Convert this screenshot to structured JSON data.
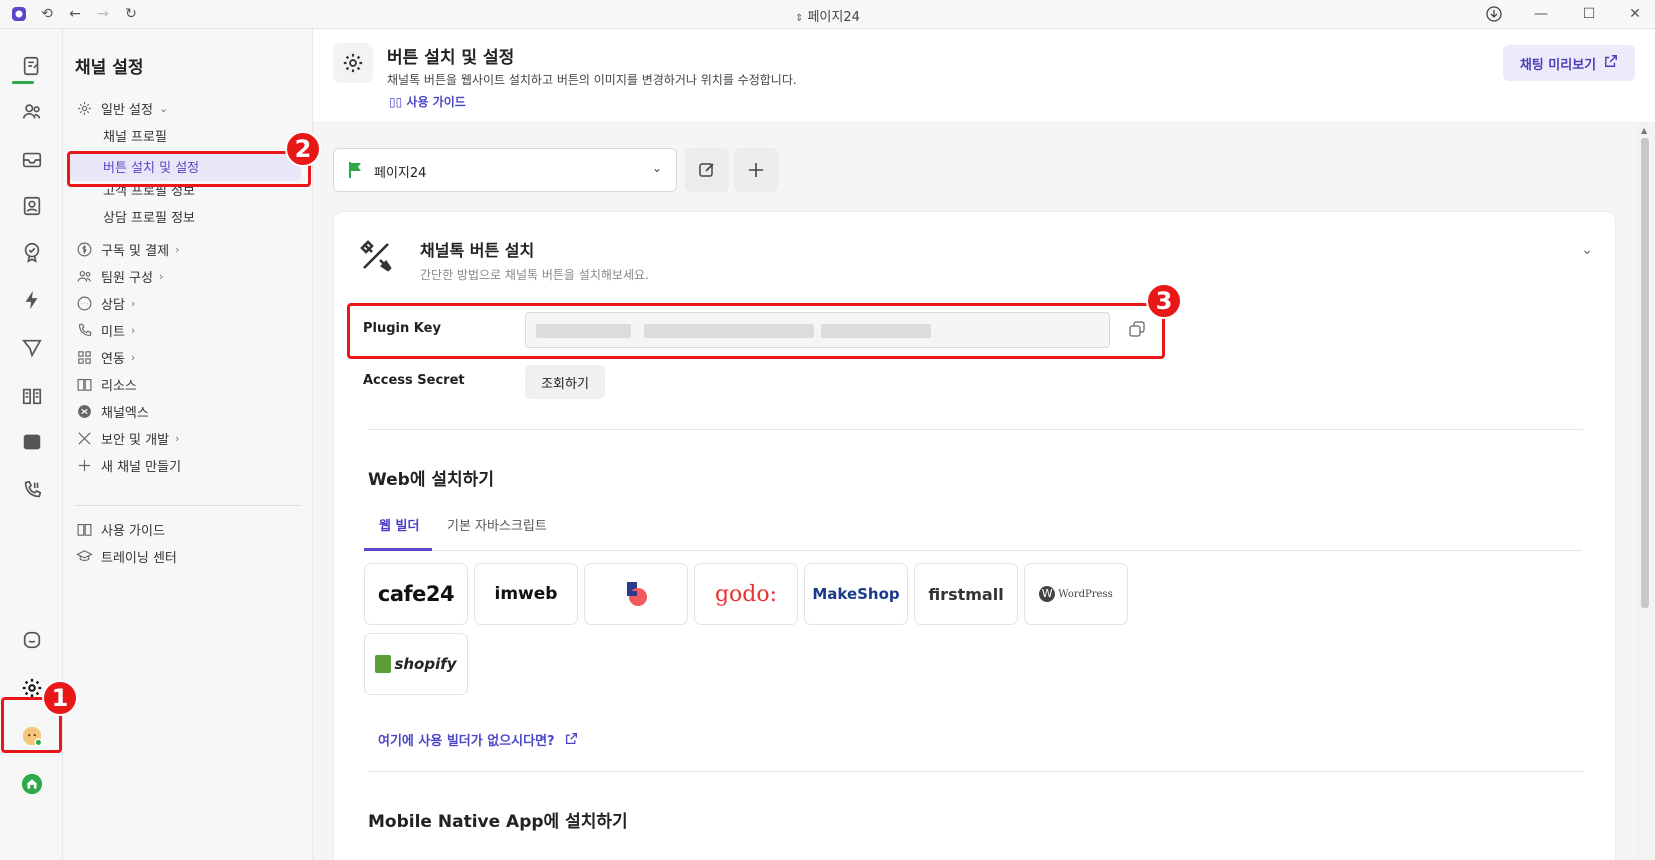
{
  "titlebar": {
    "title": "페이지24"
  },
  "sidebar": {
    "heading": "채널 설정",
    "general": "일반 설정",
    "sub": {
      "profile": "채널 프로필",
      "button_settings": "버튼 설치 및 설정",
      "customer_profile": "고객 프로필 정보",
      "consult_profile": "상담 프로필 정보"
    },
    "items": [
      {
        "label": "구독 및 결제",
        "icon": "dollar-icon",
        "caret": true
      },
      {
        "label": "팀원 구성",
        "icon": "team-icon",
        "caret": true
      },
      {
        "label": "상담",
        "icon": "chat-icon",
        "caret": true
      },
      {
        "label": "미트",
        "icon": "phone-icon",
        "caret": true
      },
      {
        "label": "연동",
        "icon": "grid-icon",
        "caret": true
      },
      {
        "label": "리소스",
        "icon": "book-icon",
        "caret": false
      },
      {
        "label": "채널엑스",
        "icon": "channelx-icon",
        "caret": false
      },
      {
        "label": "보안 및 개발",
        "icon": "tools-icon",
        "caret": true
      },
      {
        "label": "새 채널 만들기",
        "icon": "plus-icon",
        "caret": false
      }
    ],
    "footer": [
      {
        "label": "사용 가이드",
        "icon": "book-icon"
      },
      {
        "label": "트레이닝 센터",
        "icon": "graduation-cap-icon"
      }
    ]
  },
  "header": {
    "title": "버튼 설치 및 설정",
    "description": "채널톡 버튼을 웹사이트 설치하고 버튼의 이미지를 변경하거나 위치를 수정합니다.",
    "guide_link": "사용 가이드",
    "preview_button": "채팅 미리보기"
  },
  "channel_select": {
    "value": "페이지24"
  },
  "card": {
    "title": "채널톡 버튼 설치",
    "description": "간단한 방법으로 채널톡 버튼을 설치해보세요.",
    "plugin_key_label": "Plugin Key",
    "access_secret_label": "Access Secret",
    "view_button": "조회하기",
    "web_section_title": "Web에 설치하기",
    "tabs": [
      "웹 빌더",
      "기본 자바스크립트"
    ],
    "builders": [
      "cafe24",
      "imweb",
      "",
      "godo:",
      "MakeShop",
      "firstmall",
      "WordPress",
      "shopify"
    ],
    "builder_link": "여기에 사용 빌더가 없으시다면?",
    "mobile_section_title": "Mobile Native App에 설치하기"
  },
  "annotations": [
    "1",
    "2",
    "3"
  ],
  "colors": {
    "accent": "#5a48c8",
    "highlight": "#e81818",
    "flag": "#2ea84a"
  }
}
